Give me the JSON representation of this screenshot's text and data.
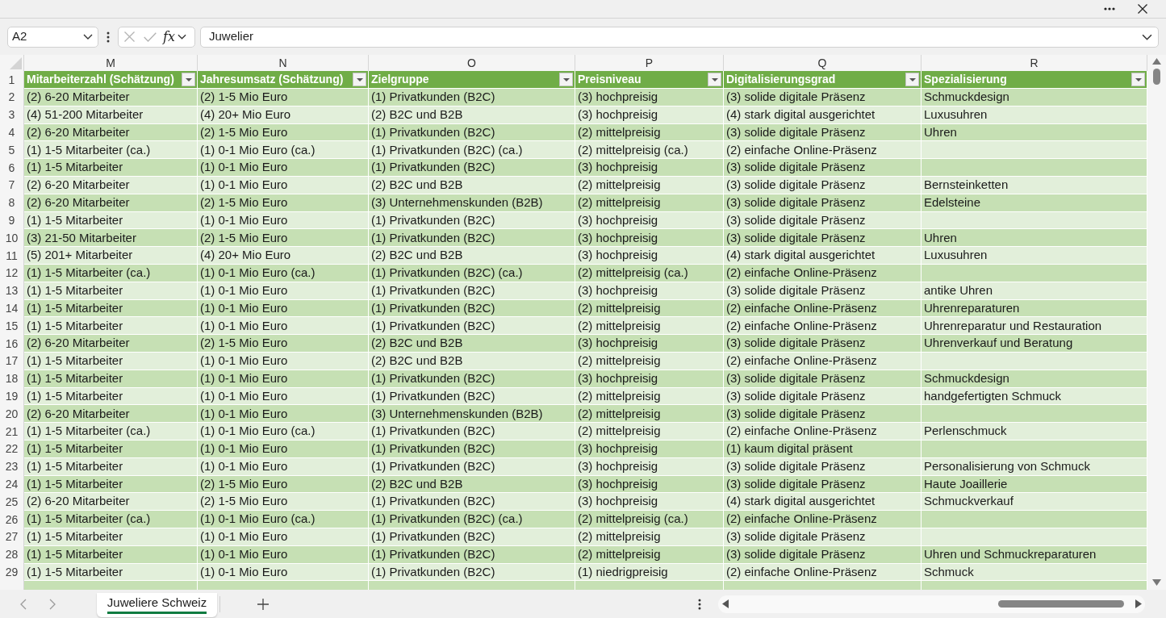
{
  "name_box": {
    "value": "A2"
  },
  "formula_bar": {
    "function_label": "fx",
    "value": "Juwelier"
  },
  "column_letters": [
    "M",
    "N",
    "O",
    "P",
    "Q",
    "R"
  ],
  "table": {
    "header_row": {
      "number": "1",
      "headers": [
        "Mitarbeiterzahl (Schätzung)",
        "Jahresumsatz (Schätzung)",
        "Zielgruppe",
        "Preisniveau",
        "Digitalisierungsgrad",
        "Spezialisierung"
      ]
    },
    "rows": [
      {
        "number": "2",
        "cells": [
          "(2) 6-20 Mitarbeiter",
          "(2) 1-5 Mio Euro",
          "(1) Privatkunden (B2C)",
          "(3) hochpreisig",
          "(3) solide digitale Präsenz",
          "Schmuckdesign"
        ]
      },
      {
        "number": "3",
        "cells": [
          "(4) 51-200 Mitarbeiter",
          "(4) 20+ Mio Euro",
          "(2) B2C und B2B",
          "(3) hochpreisig",
          "(4) stark digital ausgerichtet",
          "Luxusuhren"
        ]
      },
      {
        "number": "4",
        "cells": [
          "(2) 6-20 Mitarbeiter",
          "(2) 1-5 Mio Euro",
          "(1) Privatkunden (B2C)",
          "(2) mittelpreisig",
          "(3) solide digitale Präsenz",
          "Uhren"
        ]
      },
      {
        "number": "5",
        "cells": [
          "(1) 1-5 Mitarbeiter (ca.)",
          "(1) 0-1 Mio Euro (ca.)",
          "(1) Privatkunden (B2C) (ca.)",
          "(2) mittelpreisig (ca.)",
          "(2) einfache Online-Präsenz"
        ]
      },
      {
        "number": "6",
        "cells": [
          "(1) 1-5 Mitarbeiter",
          "(1) 0-1 Mio Euro",
          "(1) Privatkunden (B2C)",
          "(3) hochpreisig",
          "(3) solide digitale Präsenz"
        ]
      },
      {
        "number": "7",
        "cells": [
          "(2) 6-20 Mitarbeiter",
          "(1) 0-1 Mio Euro",
          "(2) B2C und B2B",
          "(2) mittelpreisig",
          "(3) solide digitale Präsenz",
          "Bernsteinketten"
        ]
      },
      {
        "number": "8",
        "cells": [
          "(2) 6-20 Mitarbeiter",
          "(2) 1-5 Mio Euro",
          "(3) Unternehmenskunden (B2B)",
          "(2) mittelpreisig",
          "(3) solide digitale Präsenz",
          "Edelsteine"
        ]
      },
      {
        "number": "9",
        "cells": [
          "(1) 1-5 Mitarbeiter",
          "(1) 0-1 Mio Euro",
          "(1) Privatkunden (B2C)",
          "(3) hochpreisig",
          "(3) solide digitale Präsenz"
        ]
      },
      {
        "number": "10",
        "cells": [
          "(3) 21-50 Mitarbeiter",
          "(2) 1-5 Mio Euro",
          "(1) Privatkunden (B2C)",
          "(3) hochpreisig",
          "(3) solide digitale Präsenz",
          "Uhren"
        ]
      },
      {
        "number": "11",
        "cells": [
          "(5) 201+ Mitarbeiter",
          "(4) 20+ Mio Euro",
          "(2) B2C und B2B",
          "(3) hochpreisig",
          "(4) stark digital ausgerichtet",
          "Luxusuhren"
        ]
      },
      {
        "number": "12",
        "cells": [
          "(1) 1-5 Mitarbeiter (ca.)",
          "(1) 0-1 Mio Euro (ca.)",
          "(1) Privatkunden (B2C) (ca.)",
          "(2) mittelpreisig (ca.)",
          "(2) einfache Online-Präsenz"
        ]
      },
      {
        "number": "13",
        "cells": [
          "(1) 1-5 Mitarbeiter",
          "(1) 0-1 Mio Euro",
          "(1) Privatkunden (B2C)",
          "(3) hochpreisig",
          "(3) solide digitale Präsenz",
          "antike Uhren"
        ]
      },
      {
        "number": "14",
        "cells": [
          "(1) 1-5 Mitarbeiter",
          "(1) 0-1 Mio Euro",
          "(1) Privatkunden (B2C)",
          "(2) mittelpreisig",
          "(2) einfache Online-Präsenz",
          "Uhrenreparaturen"
        ]
      },
      {
        "number": "15",
        "cells": [
          "(1) 1-5 Mitarbeiter",
          "(1) 0-1 Mio Euro",
          "(1) Privatkunden (B2C)",
          "(2) mittelpreisig",
          "(2) einfache Online-Präsenz",
          "Uhrenreparatur und Restauration"
        ]
      },
      {
        "number": "16",
        "cells": [
          "(2) 6-20 Mitarbeiter",
          "(2) 1-5 Mio Euro",
          "(2) B2C und B2B",
          "(3) hochpreisig",
          "(3) solide digitale Präsenz",
          "Uhrenverkauf und Beratung"
        ]
      },
      {
        "number": "17",
        "cells": [
          "(1) 1-5 Mitarbeiter",
          "(1) 0-1 Mio Euro",
          "(2) B2C und B2B",
          "(2) mittelpreisig",
          "(2) einfache Online-Präsenz"
        ]
      },
      {
        "number": "18",
        "cells": [
          "(1) 1-5 Mitarbeiter",
          "(1) 0-1 Mio Euro",
          "(1) Privatkunden (B2C)",
          "(3) hochpreisig",
          "(3) solide digitale Präsenz",
          "Schmuckdesign"
        ]
      },
      {
        "number": "19",
        "cells": [
          "(1) 1-5 Mitarbeiter",
          "(1) 0-1 Mio Euro",
          "(1) Privatkunden (B2C)",
          "(2) mittelpreisig",
          "(3) solide digitale Präsenz",
          "handgefertigten Schmuck"
        ]
      },
      {
        "number": "20",
        "cells": [
          "(2) 6-20 Mitarbeiter",
          "(1) 0-1 Mio Euro",
          "(3) Unternehmenskunden (B2B)",
          "(2) mittelpreisig",
          "(3) solide digitale Präsenz"
        ]
      },
      {
        "number": "21",
        "cells": [
          "(1) 1-5 Mitarbeiter (ca.)",
          "(1) 0-1 Mio Euro (ca.)",
          "(1) Privatkunden (B2C)",
          "(2) mittelpreisig",
          "(2) einfache Online-Präsenz",
          "Perlenschmuck"
        ]
      },
      {
        "number": "22",
        "cells": [
          "(1) 1-5 Mitarbeiter",
          "(1) 0-1 Mio Euro",
          "(1) Privatkunden (B2C)",
          "(3) hochpreisig",
          "(1) kaum digital präsent"
        ]
      },
      {
        "number": "23",
        "cells": [
          "(1) 1-5 Mitarbeiter",
          "(1) 0-1 Mio Euro",
          "(1) Privatkunden (B2C)",
          "(3) hochpreisig",
          "(3) solide digitale Präsenz",
          "Personalisierung von Schmuck"
        ]
      },
      {
        "number": "24",
        "cells": [
          "(1) 1-5 Mitarbeiter",
          "(2) 1-5 Mio Euro",
          "(2) B2C und B2B",
          "(3) hochpreisig",
          "(3) solide digitale Präsenz",
          "Haute Joaillerie"
        ]
      },
      {
        "number": "25",
        "cells": [
          "(2) 6-20 Mitarbeiter",
          "(2) 1-5 Mio Euro",
          "(1) Privatkunden (B2C)",
          "(3) hochpreisig",
          "(4) stark digital ausgerichtet",
          "Schmuckverkauf"
        ]
      },
      {
        "number": "26",
        "cells": [
          "(1) 1-5 Mitarbeiter (ca.)",
          "(1) 0-1 Mio Euro (ca.)",
          "(1) Privatkunden (B2C) (ca.)",
          "(2) mittelpreisig (ca.)",
          "(2) einfache Online-Präsenz"
        ]
      },
      {
        "number": "27",
        "cells": [
          "(1) 1-5 Mitarbeiter",
          "(1) 0-1 Mio Euro",
          "(1) Privatkunden (B2C)",
          "(2) mittelpreisig",
          "(3) solide digitale Präsenz"
        ]
      },
      {
        "number": "28",
        "cells": [
          "(1) 1-5 Mitarbeiter",
          "(1) 0-1 Mio Euro",
          "(1) Privatkunden (B2C)",
          "(2) mittelpreisig",
          "(3) solide digitale Präsenz",
          "Uhren und Schmuckreparaturen"
        ]
      },
      {
        "number": "29",
        "cells": [
          "(1) 1-5 Mitarbeiter",
          "(1) 0-1 Mio Euro",
          "(1) Privatkunden (B2C)",
          "(1) niedrigpreisig",
          "(2) einfache Online-Präsenz",
          "Schmuck"
        ]
      }
    ]
  },
  "sheet_tabs": [
    {
      "label": "Juweliere Schweiz",
      "selected": true
    }
  ]
}
